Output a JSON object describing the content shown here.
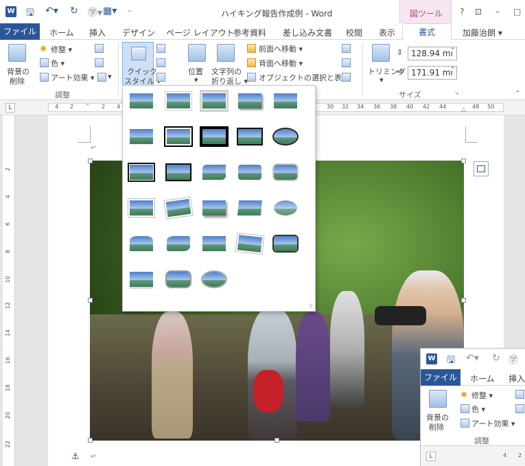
{
  "titlebar": {
    "title": "ハイキング報告作成例 - Word",
    "context_tab": "図ツール",
    "help": "?",
    "minimize": "–",
    "maximize": "□",
    "ribbon_options": "⊡"
  },
  "tabs": {
    "file": "ファイル",
    "home": "ホーム",
    "insert": "挿入",
    "design": "デザイン",
    "page_layout": "ページ レイアウト",
    "references": "参考資料",
    "mailings": "差し込み文書",
    "review": "校閲",
    "view": "表示",
    "format": "書式",
    "user": "加藤治朗"
  },
  "ribbon": {
    "remove_background": [
      "背景の",
      "削除"
    ],
    "corrections": "修整",
    "color": "色",
    "artistic_effects": "アート効果",
    "adjust_group": "調整",
    "quick_styles": [
      "クイック",
      "スタイル"
    ],
    "position": "位置",
    "wrap_text": [
      "文字列の",
      "折り返し"
    ],
    "bring_forward": "前面へ移動",
    "send_backward": "背面へ移動",
    "selection_pane": "オブジェクトの選択と表示",
    "crop": "トリミング",
    "height": "128.94 mı",
    "width": "171.91 mı",
    "size_group": "サイズ"
  },
  "ruler": {
    "ticks": [
      "4",
      "2",
      "2",
      "4",
      "30",
      "32",
      "34",
      "36",
      "38",
      "40",
      "42",
      "44",
      "48",
      "50"
    ],
    "tab_selector": "L"
  },
  "vruler": {
    "ticks": [
      "2",
      "4",
      "6",
      "8",
      "10",
      "12",
      "14",
      "16",
      "18",
      "20",
      "22"
    ]
  },
  "mini_window": {
    "file": "ファイル",
    "home": "ホーム",
    "insert": "挿入",
    "corrections": "修整",
    "color": "色",
    "artistic_effects": "アート効果",
    "remove_background": [
      "背景の",
      "削除"
    ],
    "adjust_group": "調整",
    "ruler_ticks": [
      "4",
      "2"
    ],
    "tab_selector": "L"
  },
  "colors": {
    "word_blue": "#2b579a",
    "context_pink": "#b0457a",
    "selected_button": "#cde0f5"
  }
}
